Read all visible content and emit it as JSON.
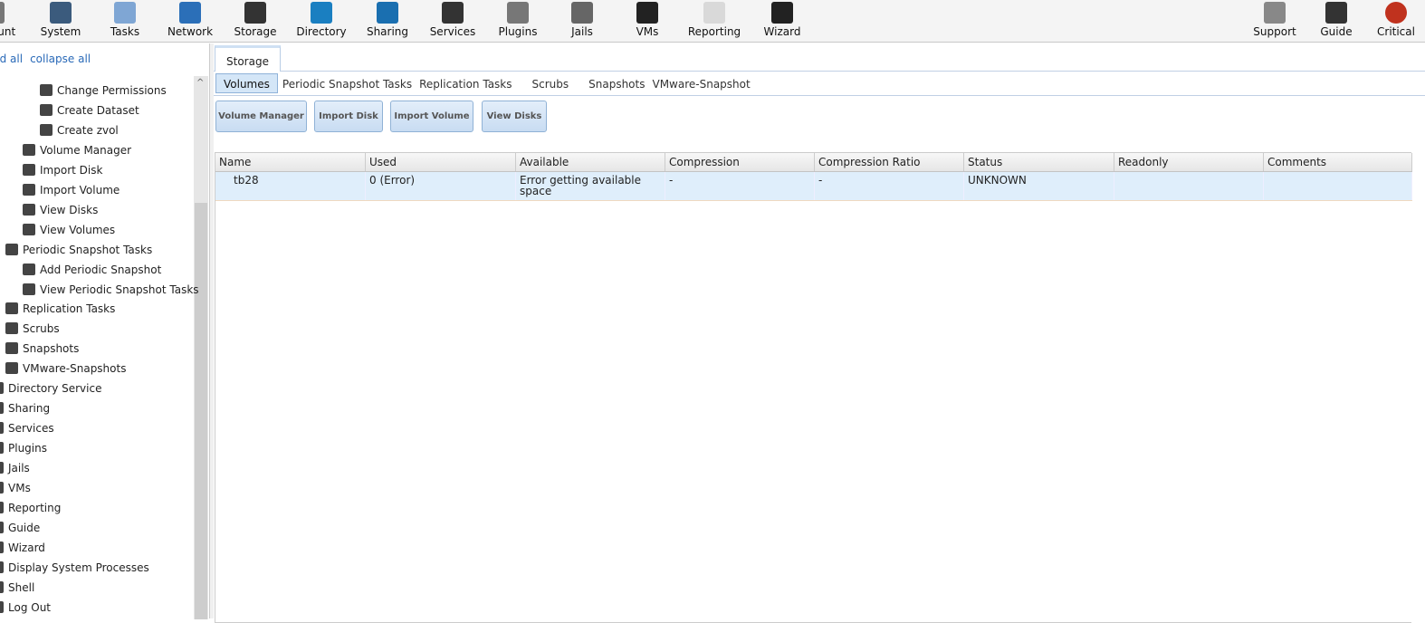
{
  "topnav": [
    {
      "label": "Account",
      "shown": "unt",
      "color": "#777"
    },
    {
      "label": "System",
      "color": "#3b5b7d"
    },
    {
      "label": "Tasks",
      "color": "#7fa6d4"
    },
    {
      "label": "Network",
      "color": "#2b6fb8"
    },
    {
      "label": "Storage",
      "color": "#333"
    },
    {
      "label": "Directory",
      "color": "#1a7fc1"
    },
    {
      "label": "Sharing",
      "color": "#1a6fb0"
    },
    {
      "label": "Services",
      "color": "#333"
    },
    {
      "label": "Plugins",
      "color": "#777"
    },
    {
      "label": "Jails",
      "color": "#666"
    },
    {
      "label": "VMs",
      "color": "#222"
    },
    {
      "label": "Reporting",
      "color": "#d9d9d9"
    },
    {
      "label": "Wizard",
      "color": "#222"
    }
  ],
  "rightnav": [
    {
      "label": "Support",
      "color": "#888"
    },
    {
      "label": "Guide",
      "color": "#333"
    },
    {
      "label": "Critical",
      "color": "#c0321e"
    }
  ],
  "sidebar": {
    "expand_all": "nd all",
    "collapse_all": "collapse all",
    "items": [
      "Change Permissions",
      "Create Dataset",
      "Create zvol",
      "Volume Manager",
      "Import Disk",
      "Import Volume",
      "View Disks",
      "View Volumes",
      "Periodic Snapshot Tasks",
      "Add Periodic Snapshot",
      "View Periodic Snapshot Tasks",
      "Replication Tasks",
      "Scrubs",
      "Snapshots",
      "VMware-Snapshots",
      "Directory Service",
      "Sharing",
      "Services",
      "Plugins",
      "Jails",
      "VMs",
      "Reporting",
      "Guide",
      "Wizard",
      "Display System Processes",
      "Shell",
      "Log Out"
    ]
  },
  "main": {
    "tab": "Storage",
    "subtabs": [
      "Volumes",
      "Periodic Snapshot Tasks",
      "Replication Tasks",
      "Scrubs",
      "Snapshots",
      "VMware-Snapshot"
    ],
    "buttons": [
      "Volume Manager",
      "Import Disk",
      "Import Volume",
      "View Disks"
    ],
    "columns": [
      "Name",
      "Used",
      "Available",
      "Compression",
      "Compression Ratio",
      "Status",
      "Readonly",
      "Comments"
    ],
    "rows": [
      [
        "tb28",
        "0 (Error)",
        "Error getting available space",
        "-",
        "-",
        "UNKNOWN",
        "",
        ""
      ]
    ]
  }
}
